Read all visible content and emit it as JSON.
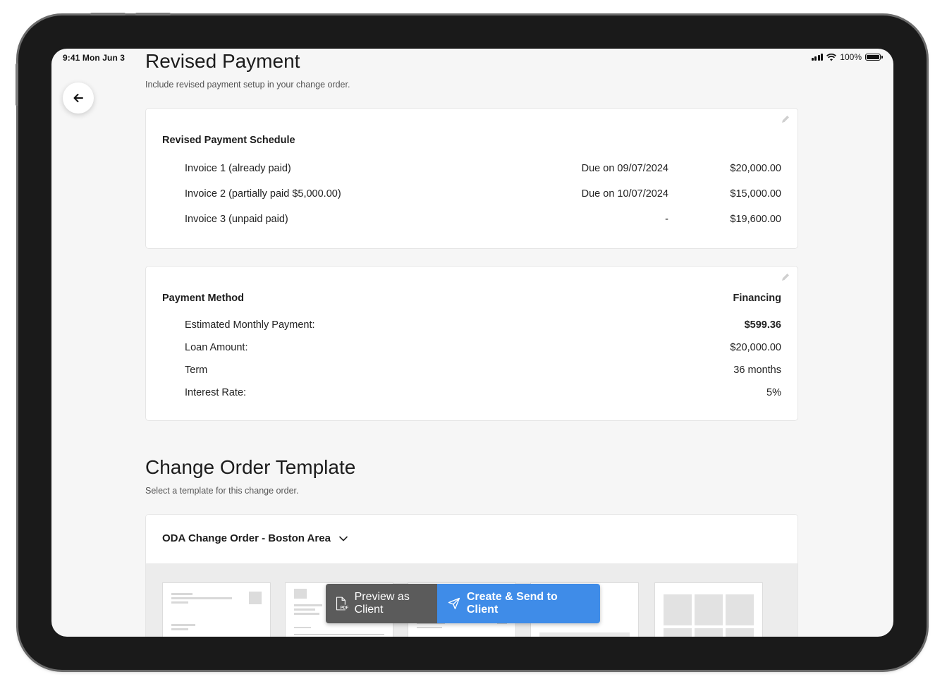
{
  "status_bar": {
    "time": "9:41  Mon Jun 3",
    "battery": "100%"
  },
  "revised_payment": {
    "title": "Revised Payment",
    "subtitle": "Include revised payment setup in your change order.",
    "schedule": {
      "title": "Revised Payment Schedule",
      "rows": [
        {
          "label": "Invoice 1 (already paid)",
          "due": "Due on 09/07/2024",
          "amount": "$20,000.00"
        },
        {
          "label": "Invoice 2 (partially paid $5,000.00)",
          "due": "Due on 10/07/2024",
          "amount": "$15,000.00"
        },
        {
          "label": "Invoice 3 (unpaid paid)",
          "due": "-",
          "amount": "$19,600.00"
        }
      ]
    },
    "method": {
      "title": "Payment Method",
      "value": "Financing",
      "rows": [
        {
          "label": "Estimated Monthly Payment:",
          "value": "$599.36"
        },
        {
          "label": "Loan Amount:",
          "value": "$20,000.00"
        },
        {
          "label": "Term",
          "value": "36 months"
        },
        {
          "label": "Interest Rate:",
          "value": "5%"
        }
      ]
    }
  },
  "template": {
    "title": "Change Order Template",
    "subtitle": "Select a template for this change order.",
    "selected": "ODA Change Order - Boston Area"
  },
  "actions": {
    "preview_label": "Preview as Client",
    "send_label": "Create & Send to Client"
  },
  "colors": {
    "accent": "#3f8ce8",
    "preview_bg": "#5b5b5b"
  }
}
